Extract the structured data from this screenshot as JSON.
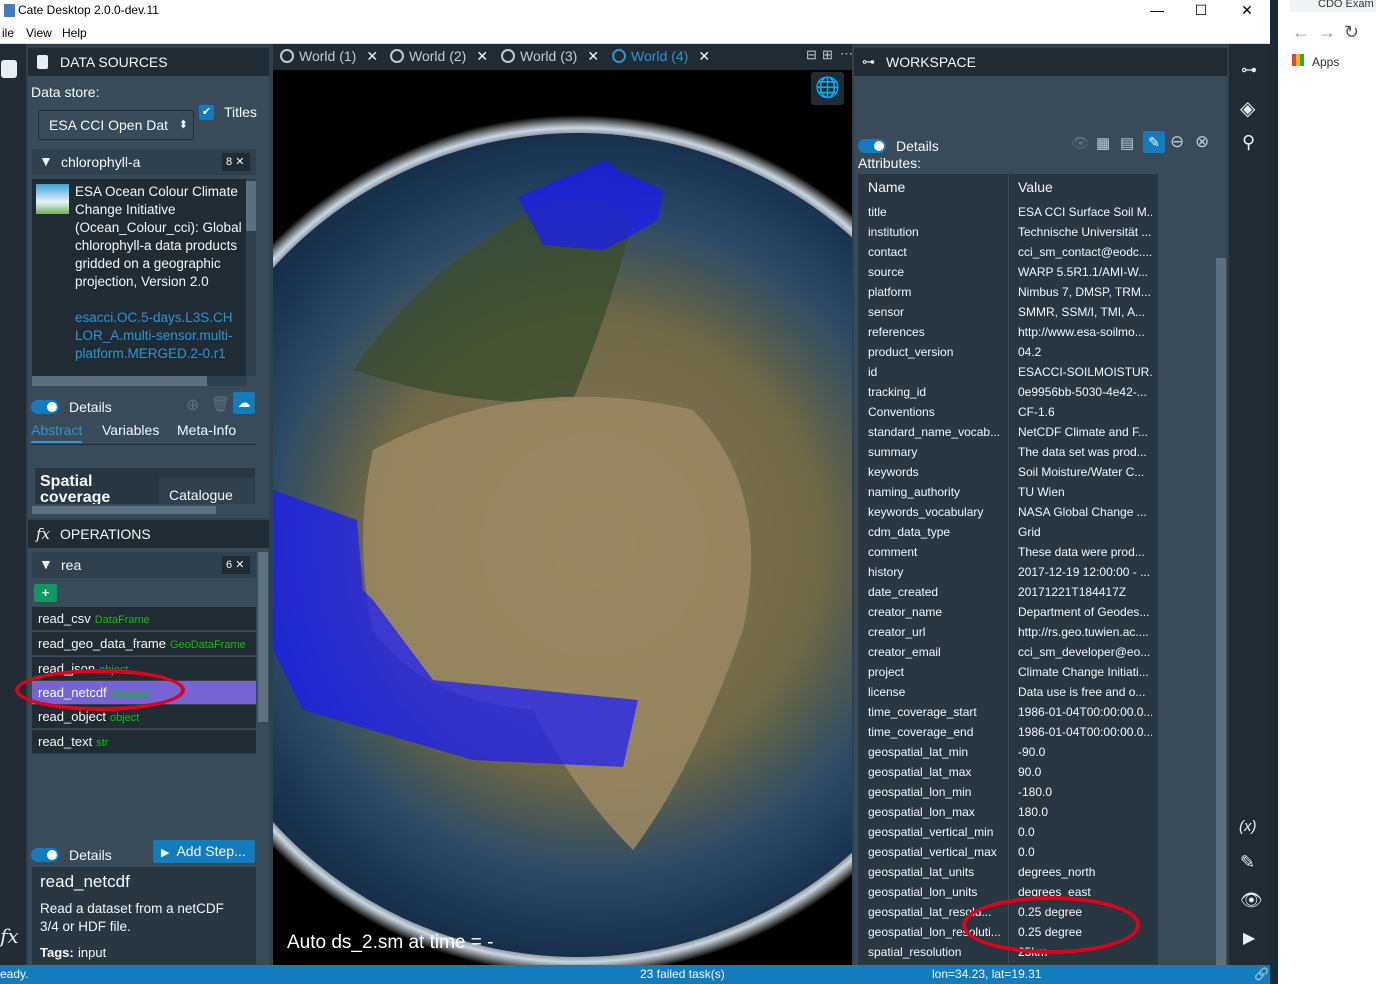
{
  "window": {
    "title": "Cate Desktop 2.0.0-dev.11",
    "min": "—",
    "max": "☐",
    "close": "✕"
  },
  "menu": {
    "file": "ile",
    "view": "View",
    "help": "Help"
  },
  "browser": {
    "tab_label": "CDO Exam",
    "apps": "Apps"
  },
  "data_sources": {
    "header": "DATA SOURCES",
    "store_label": "Data store:",
    "store_value": "ESA CCI Open Dat",
    "titles_label": "Titles",
    "filter_text": "chlorophyll-a",
    "filter_count": "8",
    "item_title": "ESA Ocean Colour Climate Change Initiative (Ocean_Colour_cci): Global chlorophyll-a data products gridded on a geographic projection, Version 2.0",
    "item_id": "esacci.OC.5-days.L3S.CHLOR_A.multi-sensor.multi-platform.MERGED.2-0.r1",
    "details_label": "Details",
    "tabs": [
      "Abstract",
      "Variables",
      "Meta-Info"
    ],
    "spatial_label": "Spatial coverage",
    "catalogue_label": "Catalogue"
  },
  "operations": {
    "header": "OPERATIONS",
    "filter_text": "rea",
    "filter_count": "6",
    "add_label": "+",
    "items": [
      {
        "name": "read_csv",
        "type": "DataFrame"
      },
      {
        "name": "read_geo_data_frame",
        "type": "GeoDataFrame"
      },
      {
        "name": "read_json",
        "type": "object"
      },
      {
        "name": "read_netcdf",
        "type": "Dataset"
      },
      {
        "name": "read_object",
        "type": "object"
      },
      {
        "name": "read_text",
        "type": "str"
      }
    ],
    "details_label": "Details",
    "add_step_label": "Add Step...",
    "selected_name": "read_netcdf",
    "selected_desc": "Read a dataset from a netCDF 3/4 or HDF file.",
    "tags_label": "Tags:",
    "tags_value": "input"
  },
  "views": {
    "tabs": [
      "World (1)",
      "World (2)",
      "World (3)",
      "World (4)"
    ],
    "active_tab": "World (4)",
    "overlay_text": "Auto ds_2.sm at time = -"
  },
  "workspace": {
    "header": "WORKSPACE",
    "details_label": "Details",
    "attributes_label": "Attributes:",
    "col_name": "Name",
    "col_value": "Value",
    "rows": [
      [
        "title",
        "ESA CCI Surface Soil M..."
      ],
      [
        "institution",
        "Technische Universität ..."
      ],
      [
        "contact",
        "cci_sm_contact@eodc...."
      ],
      [
        "source",
        "WARP 5.5R1.1/AMI-W..."
      ],
      [
        "platform",
        "Nimbus 7, DMSP, TRM..."
      ],
      [
        "sensor",
        "SMMR, SSM/I, TMI, A..."
      ],
      [
        "references",
        "http://www.esa-soilmo..."
      ],
      [
        "product_version",
        "04.2"
      ],
      [
        "id",
        "ESACCI-SOILMOISTUR..."
      ],
      [
        "tracking_id",
        "0e9956bb-5030-4e42-..."
      ],
      [
        "Conventions",
        "CF-1.6"
      ],
      [
        "standard_name_vocab...",
        "NetCDF Climate and F..."
      ],
      [
        "summary",
        "The data set was prod..."
      ],
      [
        "keywords",
        "Soil Moisture/Water C..."
      ],
      [
        "naming_authority",
        "TU Wien"
      ],
      [
        "keywords_vocabulary",
        "NASA Global Change ..."
      ],
      [
        "cdm_data_type",
        "Grid"
      ],
      [
        "comment",
        "These data were prod..."
      ],
      [
        "history",
        "2017-12-19 12:00:00 - ..."
      ],
      [
        "date_created",
        "20171221T184417Z"
      ],
      [
        "creator_name",
        "Department of Geodes..."
      ],
      [
        "creator_url",
        "http://rs.geo.tuwien.ac...."
      ],
      [
        "creator_email",
        "cci_sm_developer@eo..."
      ],
      [
        "project",
        "Climate Change Initiati..."
      ],
      [
        "license",
        "Data use is free and o..."
      ],
      [
        "time_coverage_start",
        "1986-01-04T00:00:00.0..."
      ],
      [
        "time_coverage_end",
        "1986-01-04T00:00:00.0..."
      ],
      [
        "geospatial_lat_min",
        "-90.0"
      ],
      [
        "geospatial_lat_max",
        "90.0"
      ],
      [
        "geospatial_lon_min",
        "-180.0"
      ],
      [
        "geospatial_lon_max",
        "180.0"
      ],
      [
        "geospatial_vertical_min",
        "0.0"
      ],
      [
        "geospatial_vertical_max",
        "0.0"
      ],
      [
        "geospatial_lat_units",
        "degrees_north"
      ],
      [
        "geospatial_lon_units",
        "degrees_east"
      ],
      [
        "geospatial_lat_resolu...",
        "0.25 degree"
      ],
      [
        "geospatial_lon_resoluti...",
        "0.25 degree"
      ],
      [
        "spatial_resolution",
        "25km"
      ]
    ]
  },
  "status": {
    "left": "eady.",
    "center": "23 failed task(s)",
    "coords": "lon=34.23, lat=19.31"
  },
  "colors": {
    "accent": "#137cbd",
    "highlight": "#e0001a",
    "selected_row": "#7564d1"
  }
}
